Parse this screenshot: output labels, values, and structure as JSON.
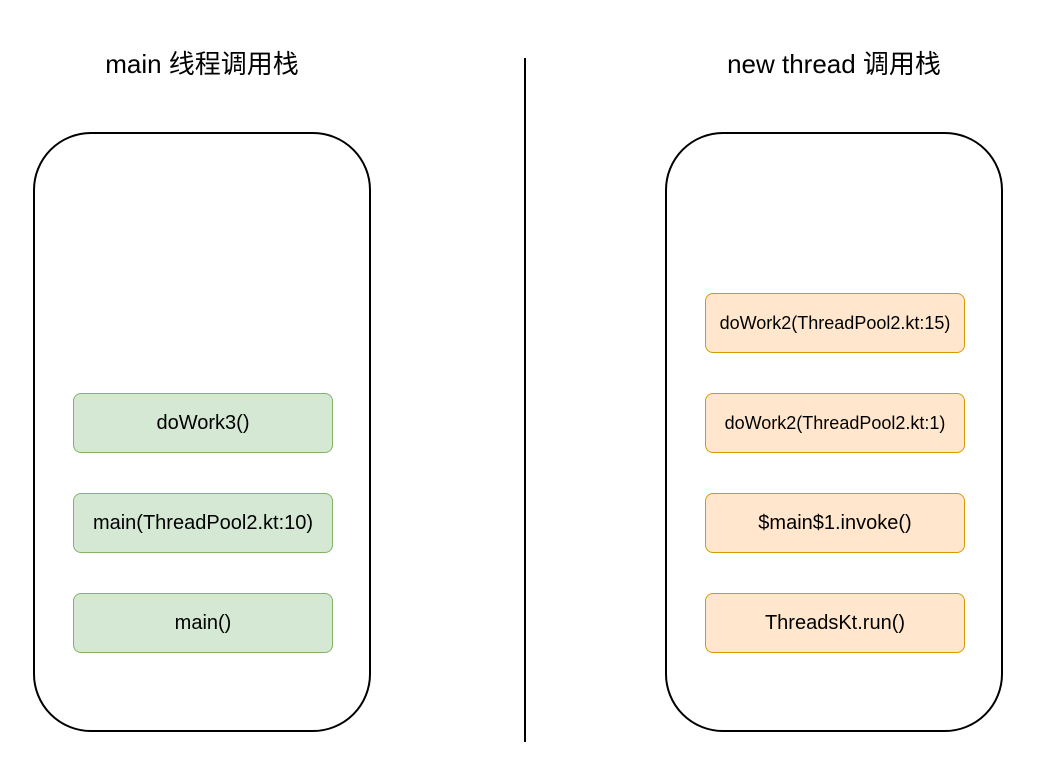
{
  "left_panel": {
    "title": "main 线程调用栈",
    "frames": [
      "doWork3()",
      "main(ThreadPool2.kt:10)",
      "main()"
    ]
  },
  "right_panel": {
    "title": "new thread 调用栈",
    "frames": [
      "doWork2(ThreadPool2.kt:15)",
      "doWork2(ThreadPool2.kt:1)",
      "$main$1.invoke()",
      "ThreadsKt.run()"
    ]
  },
  "colors": {
    "main_frame_fill": "#d5e8d4",
    "main_frame_border": "#82b366",
    "thread_frame_fill": "#ffe6cc",
    "thread_frame_border": "#d79b00"
  }
}
